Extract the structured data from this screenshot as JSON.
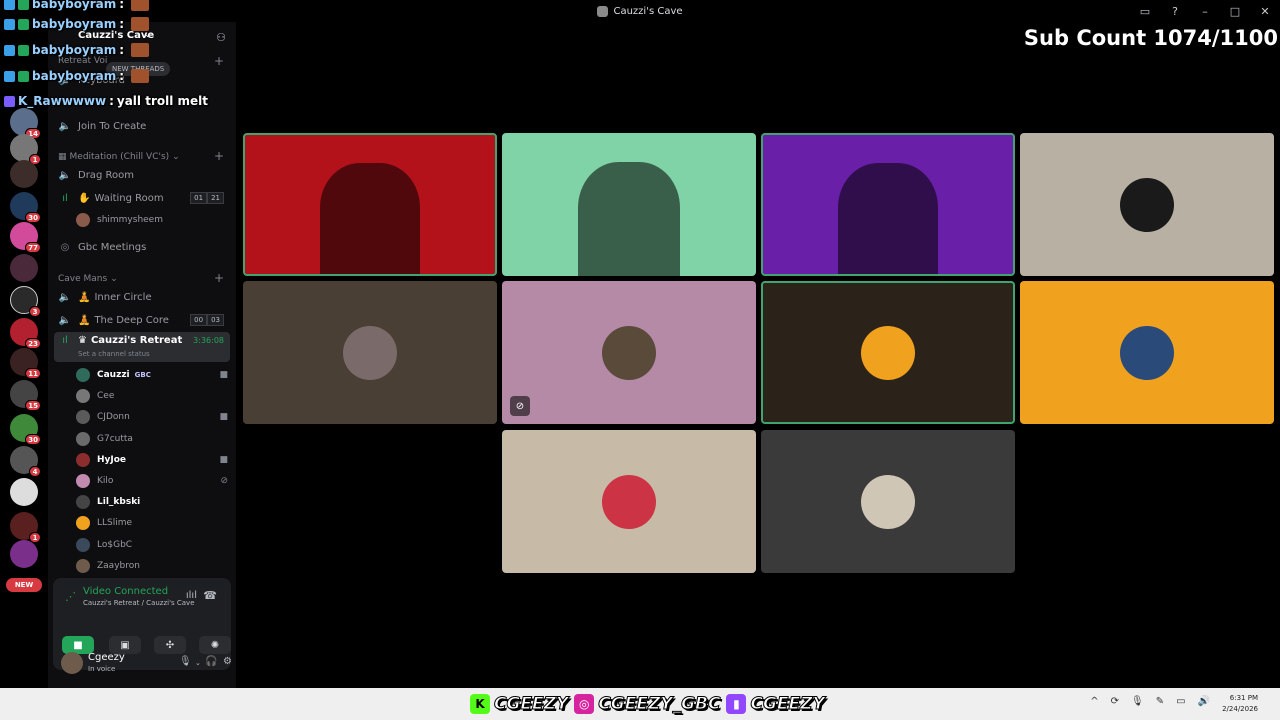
{
  "window": {
    "title": "Cauzzi's Cave",
    "controls": [
      "inbox-icon",
      "help-icon",
      "minimize-icon",
      "maximize-icon",
      "close-icon"
    ]
  },
  "overlay": {
    "sub_count": "Sub Count 1074/1100",
    "chat": [
      {
        "user": "babyboyram",
        "message": ":"
      },
      {
        "user": "babyboyram",
        "message": ":"
      },
      {
        "user": "babyboyram",
        "message": ":"
      },
      {
        "user": "K_Rawwwww",
        "message": "yall troll melt"
      }
    ]
  },
  "rail": {
    "badges": [
      "14",
      "1",
      "30",
      "77",
      "3",
      "23",
      "11",
      "15",
      "30",
      "4",
      "1"
    ],
    "new_label": "NEW"
  },
  "server": {
    "name": "Cauzzi's Cave",
    "new_threads": "NEW THREADS",
    "categories": {
      "retreat": "Retreat Voi",
      "meditation": "Meditation (Chill VC's)",
      "cave_mans": "Cave Mans"
    },
    "channels": {
      "keyboard": "Keyboard",
      "join_to_create": "Join To Create",
      "drag_room": "Drag Room",
      "waiting_room": "Waiting Room",
      "waiting_counts": [
        "01",
        "21"
      ],
      "waiting_member": "shimmysheem",
      "gbc_meetings": "Gbc Meetings",
      "inner_circle": "Inner Circle",
      "deep_core": "The Deep Core",
      "deep_core_counts": [
        "00",
        "03"
      ],
      "active": "Cauzzi's Retreat",
      "active_time": "3:36:08",
      "active_status": "Set a channel status"
    },
    "members": [
      {
        "name": "Cauzzi",
        "tag": "GBC",
        "bold": true,
        "icon": "video-icon"
      },
      {
        "name": "Cee",
        "bold": false,
        "icon": ""
      },
      {
        "name": "CJDonn",
        "bold": false,
        "icon": "video-icon"
      },
      {
        "name": "G7cutta",
        "bold": false,
        "icon": ""
      },
      {
        "name": "HyJoe",
        "bold": true,
        "icon": "video-icon"
      },
      {
        "name": "Kilo",
        "bold": false,
        "icon": "muted-icon"
      },
      {
        "name": "Lil_kbski",
        "bold": true,
        "icon": ""
      },
      {
        "name": "LLSlime",
        "bold": false,
        "icon": ""
      },
      {
        "name": "Lo$GbC",
        "bold": false,
        "icon": ""
      },
      {
        "name": "Zaaybron",
        "bold": false,
        "icon": ""
      }
    ]
  },
  "voice": {
    "status": "Video Connected",
    "location": "Cauzzi's Retreat / Cauzzi's Cave"
  },
  "user": {
    "name": "Cgeezy",
    "status": "In voice"
  },
  "tiles": [
    {
      "kind": "video",
      "color": "#b3121b",
      "speaking": true
    },
    {
      "kind": "video",
      "color": "#7fd3a6",
      "speaking": false
    },
    {
      "kind": "video",
      "color": "#6a1fa8",
      "speaking": true
    },
    {
      "kind": "avatar",
      "color": "#b8b0a2",
      "speaking": false
    },
    {
      "kind": "avatar",
      "color": "#4a3f34",
      "speaking": false
    },
    {
      "kind": "avatar",
      "color": "#b48aa6",
      "speaking": false,
      "muted": true
    },
    {
      "kind": "avatar",
      "color": "#2b2219",
      "speaking": true
    },
    {
      "kind": "avatar",
      "color": "#f0a21e",
      "speaking": false
    },
    {
      "kind": "avatar",
      "color": "#c7bba8",
      "speaking": false
    },
    {
      "kind": "avatar",
      "color": "#3a3a3a",
      "speaking": false
    }
  ],
  "taskbar": {
    "socials": [
      {
        "platform": "kick-icon",
        "handle": "CGEEZY",
        "color": "#53fc18"
      },
      {
        "platform": "instagram-icon",
        "handle": "CGEEZY_GBC",
        "color": "#d6249f"
      },
      {
        "platform": "twitch-icon",
        "handle": "CGEEZY",
        "color": "#9146ff"
      }
    ],
    "time": "6:31 PM",
    "date": "2/24/2026"
  }
}
